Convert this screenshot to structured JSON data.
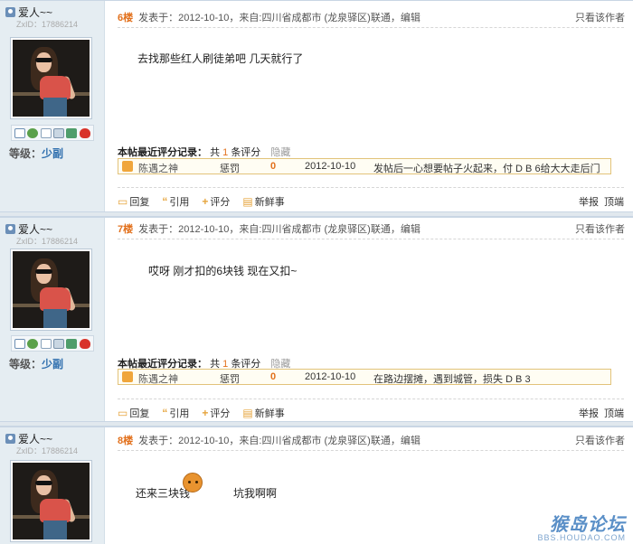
{
  "posts": [
    {
      "username": "爱人~~",
      "zxid_label": "ZxID：",
      "zxid": "17886214",
      "level_label": "等级：",
      "level": "少副",
      "floor": "6楼",
      "meta": "发表于：2012-10-10，来自:四川省成都市 (龙泉驿区)联通，编辑",
      "author_only": "只看该作者",
      "content": "去找那些红人刷徒弟吧  几天就行了",
      "rating": {
        "head_prefix": "本帖最近评分记录：",
        "count_text_a": "共",
        "count": "1",
        "count_text_b": "条评分",
        "hide": "隐藏",
        "rater": "陈遇之神",
        "type": "惩罚",
        "score": "0",
        "date": "2012-10-10",
        "reason": "发帖后一心想要帖子火起来，付 D B 6给大大走后门"
      }
    },
    {
      "username": "爱人~~",
      "zxid_label": "ZxID：",
      "zxid": "17886214",
      "level_label": "等级：",
      "level": "少副",
      "floor": "7楼",
      "meta": "发表于：2012-10-10，来自:四川省成都市 (龙泉驿区)联通，编辑",
      "author_only": "只看该作者",
      "content": "哎呀 刚才扣的6块钱  现在又扣~",
      "rating": {
        "head_prefix": "本帖最近评分记录：",
        "count_text_a": "共",
        "count": "1",
        "count_text_b": "条评分",
        "hide": "隐藏",
        "rater": "陈遇之神",
        "type": "惩罚",
        "score": "0",
        "date": "2012-10-10",
        "reason": "在路边摆摊，遇到城管，损失 D B 3"
      }
    },
    {
      "username": "爱人~~",
      "zxid_label": "ZxID：",
      "zxid": "17886214",
      "floor": "8楼",
      "meta": "发表于：2012-10-10，来自:四川省成都市 (龙泉驿区)联通，编辑",
      "author_only": "只看该作者",
      "content_a": "还来三块钱",
      "content_b": "坑我啊啊"
    }
  ],
  "actions": {
    "reply": "回复",
    "quote": "引用",
    "rate": "评分",
    "fresh": "新鲜事",
    "report": "举报",
    "top": "顶端"
  },
  "icons": [
    "mail-icon",
    "add-friend-icon",
    "profile-icon",
    "card-icon",
    "group-icon",
    "qq-icon"
  ],
  "watermark": {
    "brand": "猴岛论坛",
    "url": "BBS.HOUDAO.COM"
  }
}
